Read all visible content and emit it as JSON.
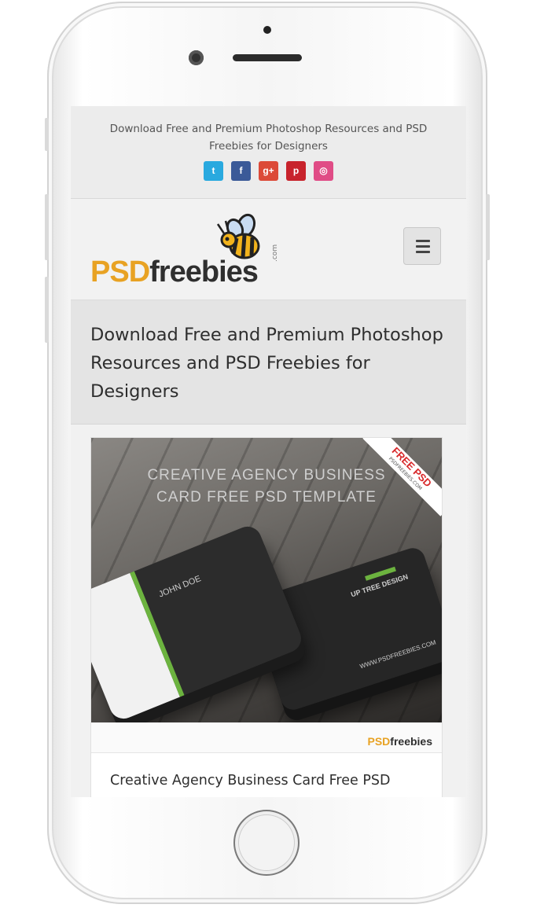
{
  "site": {
    "tagline": "Download Free and Premium Photoshop Resources and PSD Freebies for Designers",
    "logo_psd": "PSD",
    "logo_freebies": "freebies",
    "logo_com": ".com"
  },
  "social": [
    {
      "name": "twitter-icon",
      "glyph": "t",
      "color": "#29a9df"
    },
    {
      "name": "facebook-icon",
      "glyph": "f",
      "color": "#3b5a98"
    },
    {
      "name": "google-plus-icon",
      "glyph": "g+",
      "color": "#dc4a38"
    },
    {
      "name": "pinterest-icon",
      "glyph": "p",
      "color": "#c8232c"
    },
    {
      "name": "dribbble-icon",
      "glyph": "◎",
      "color": "#e04c86"
    }
  ],
  "hero": {
    "title": "Download Free and Premium Photoshop Resources and PSD Freebies for Designers"
  },
  "post": {
    "thumb_title_line1": "CREATIVE AGENCY BUSINESS",
    "thumb_title_line2": "CARD FREE PSD TEMPLATE",
    "ribbon_main": "FREE PSD",
    "ribbon_sub": "PSDFREEBIES.COM",
    "card_brand": "UP TREE DESIGN",
    "card_name": "JOHN DOE",
    "card_website": "WWW.PSDFREEBIES.COM",
    "footer_logo_psd": "PSD",
    "footer_logo_freebies": "freebies",
    "title": "Creative Agency Business Card Free PSD"
  }
}
